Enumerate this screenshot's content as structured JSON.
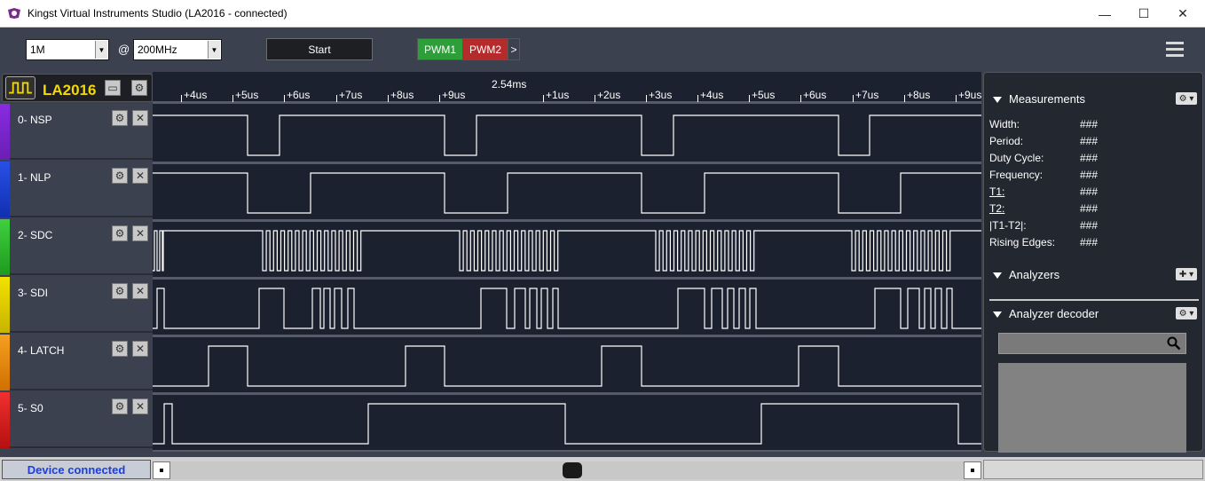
{
  "window": {
    "title": "Kingst Virtual Instruments Studio (LA2016 - connected)",
    "minimize": "—",
    "maximize": "☐",
    "close": "✕"
  },
  "toolbar": {
    "sample_depth": "1M",
    "at_symbol": "@",
    "sample_rate": "200MHz",
    "start_label": "Start",
    "pwm1_label": "PWM1",
    "pwm2_label": "PWM2",
    "more_label": ">",
    "colors": {
      "pwm1": "#2e9e3a",
      "pwm2": "#b52a2a"
    }
  },
  "device": {
    "name": "LA2016",
    "status": "Device connected"
  },
  "channels": [
    {
      "label": "0-  NSP",
      "color": "#8a2be2"
    },
    {
      "label": "1-  NLP",
      "color": "#1c3fd6"
    },
    {
      "label": "2-  SDC",
      "color": "#2fb52f"
    },
    {
      "label": "3-  SDI",
      "color": "#e6d200"
    },
    {
      "label": "4-  LATCH",
      "color": "#f08a00"
    },
    {
      "label": "5-  S0",
      "color": "#e21b1b"
    }
  ],
  "ruler": {
    "center_time": "2.54ms",
    "ticks": [
      "+4us",
      "+5us",
      "+6us",
      "+7us",
      "+8us",
      "+9us",
      "+1us",
      "+2us",
      "+3us",
      "+4us",
      "+5us",
      "+6us",
      "+7us",
      "+8us",
      "+9us"
    ]
  },
  "measurements": {
    "title": "Measurements",
    "rows": [
      {
        "key": "Width:",
        "value": "###"
      },
      {
        "key": "Period:",
        "value": "###"
      },
      {
        "key": "Duty Cycle:",
        "value": "###"
      },
      {
        "key": "Frequency:",
        "value": "###"
      },
      {
        "key": "T1:",
        "value": "###"
      },
      {
        "key": "T2:",
        "value": "###"
      },
      {
        "key": "|T1-T2|:",
        "value": "###"
      },
      {
        "key": "Rising Edges:",
        "value": "###"
      }
    ]
  },
  "analyzers": {
    "title": "Analyzers"
  },
  "decoder": {
    "title": "Analyzer decoder",
    "search_value": ""
  }
}
